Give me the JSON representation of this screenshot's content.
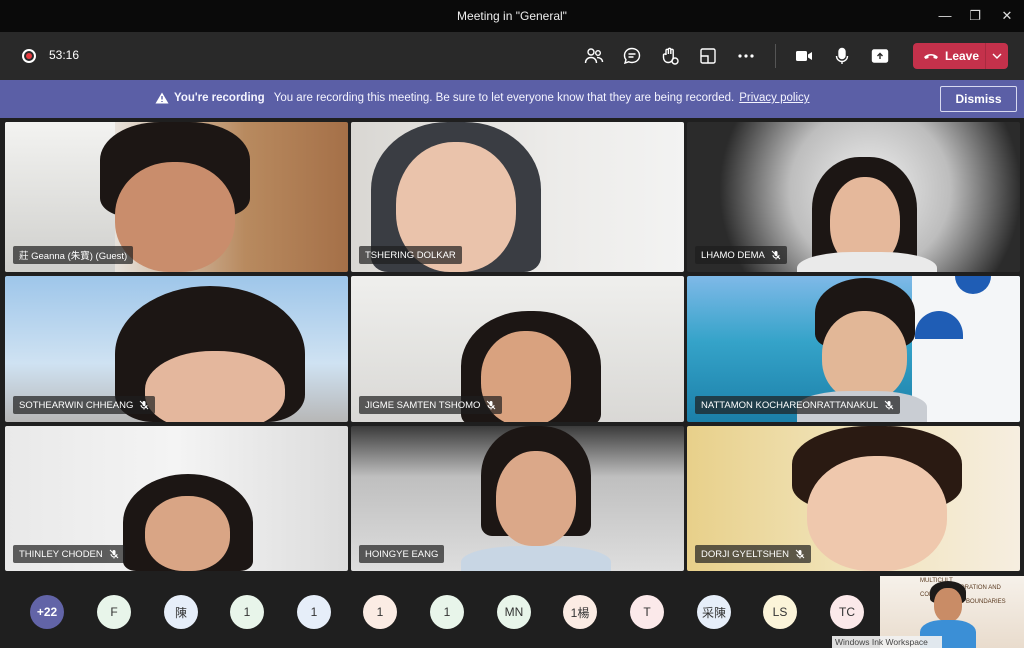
{
  "window": {
    "title": "Meeting in \"General\""
  },
  "toolbar": {
    "timer": "53:16",
    "leave_label": "Leave",
    "icons": [
      "people-icon",
      "chat-icon",
      "reactions-icon",
      "rooms-icon",
      "more-icon",
      "camera-icon",
      "mic-icon",
      "share-icon"
    ]
  },
  "banner": {
    "heading": "You're recording",
    "message": "You are recording this meeting. Be sure to let everyone know that they are being recorded.",
    "link": "Privacy policy",
    "dismiss_label": "Dismiss"
  },
  "participants": [
    {
      "name": "莊 Geanna (朱寶) (Guest)",
      "muted": false
    },
    {
      "name": "TSHERING DOLKAR",
      "muted": false
    },
    {
      "name": "LHAMO DEMA",
      "muted": true
    },
    {
      "name": "SOTHEARWIN CHHEANG",
      "muted": true
    },
    {
      "name": "JIGME SAMTEN TSHOMO",
      "muted": true
    },
    {
      "name": "NATTAMON KOCHAREONRATTANAKUL",
      "muted": true
    },
    {
      "name": "THINLEY CHODEN",
      "muted": true
    },
    {
      "name": "HOINGYE EANG",
      "muted": false
    },
    {
      "name": "DORJI GYELTSHEN",
      "muted": true
    }
  ],
  "avatars": [
    {
      "label": "+22",
      "color": "#6264a7"
    },
    {
      "label": "F",
      "color": "#e8f5ea"
    },
    {
      "label": "陳",
      "color": "#e6eef9"
    },
    {
      "label": "1",
      "color": "#e8f5ea"
    },
    {
      "label": "1",
      "color": "#e6eef9"
    },
    {
      "label": "1",
      "color": "#fbece4"
    },
    {
      "label": "1",
      "color": "#e8f5ea"
    },
    {
      "label": "MN",
      "color": "#e8f5ea"
    },
    {
      "label": "1楊",
      "color": "#fbece4"
    },
    {
      "label": "T",
      "color": "#fbe9ea"
    },
    {
      "label": "采陳",
      "color": "#e6eef9"
    },
    {
      "label": "LS",
      "color": "#fbf4d9"
    },
    {
      "label": "TC",
      "color": "#fbe9ea"
    }
  ],
  "overlay": {
    "slide_lines": [
      "MULTICULT",
      "ORATION AND",
      "COMMUNIC",
      "D BOUNDARIES"
    ],
    "ink_label": "Windows Ink Workspace"
  }
}
